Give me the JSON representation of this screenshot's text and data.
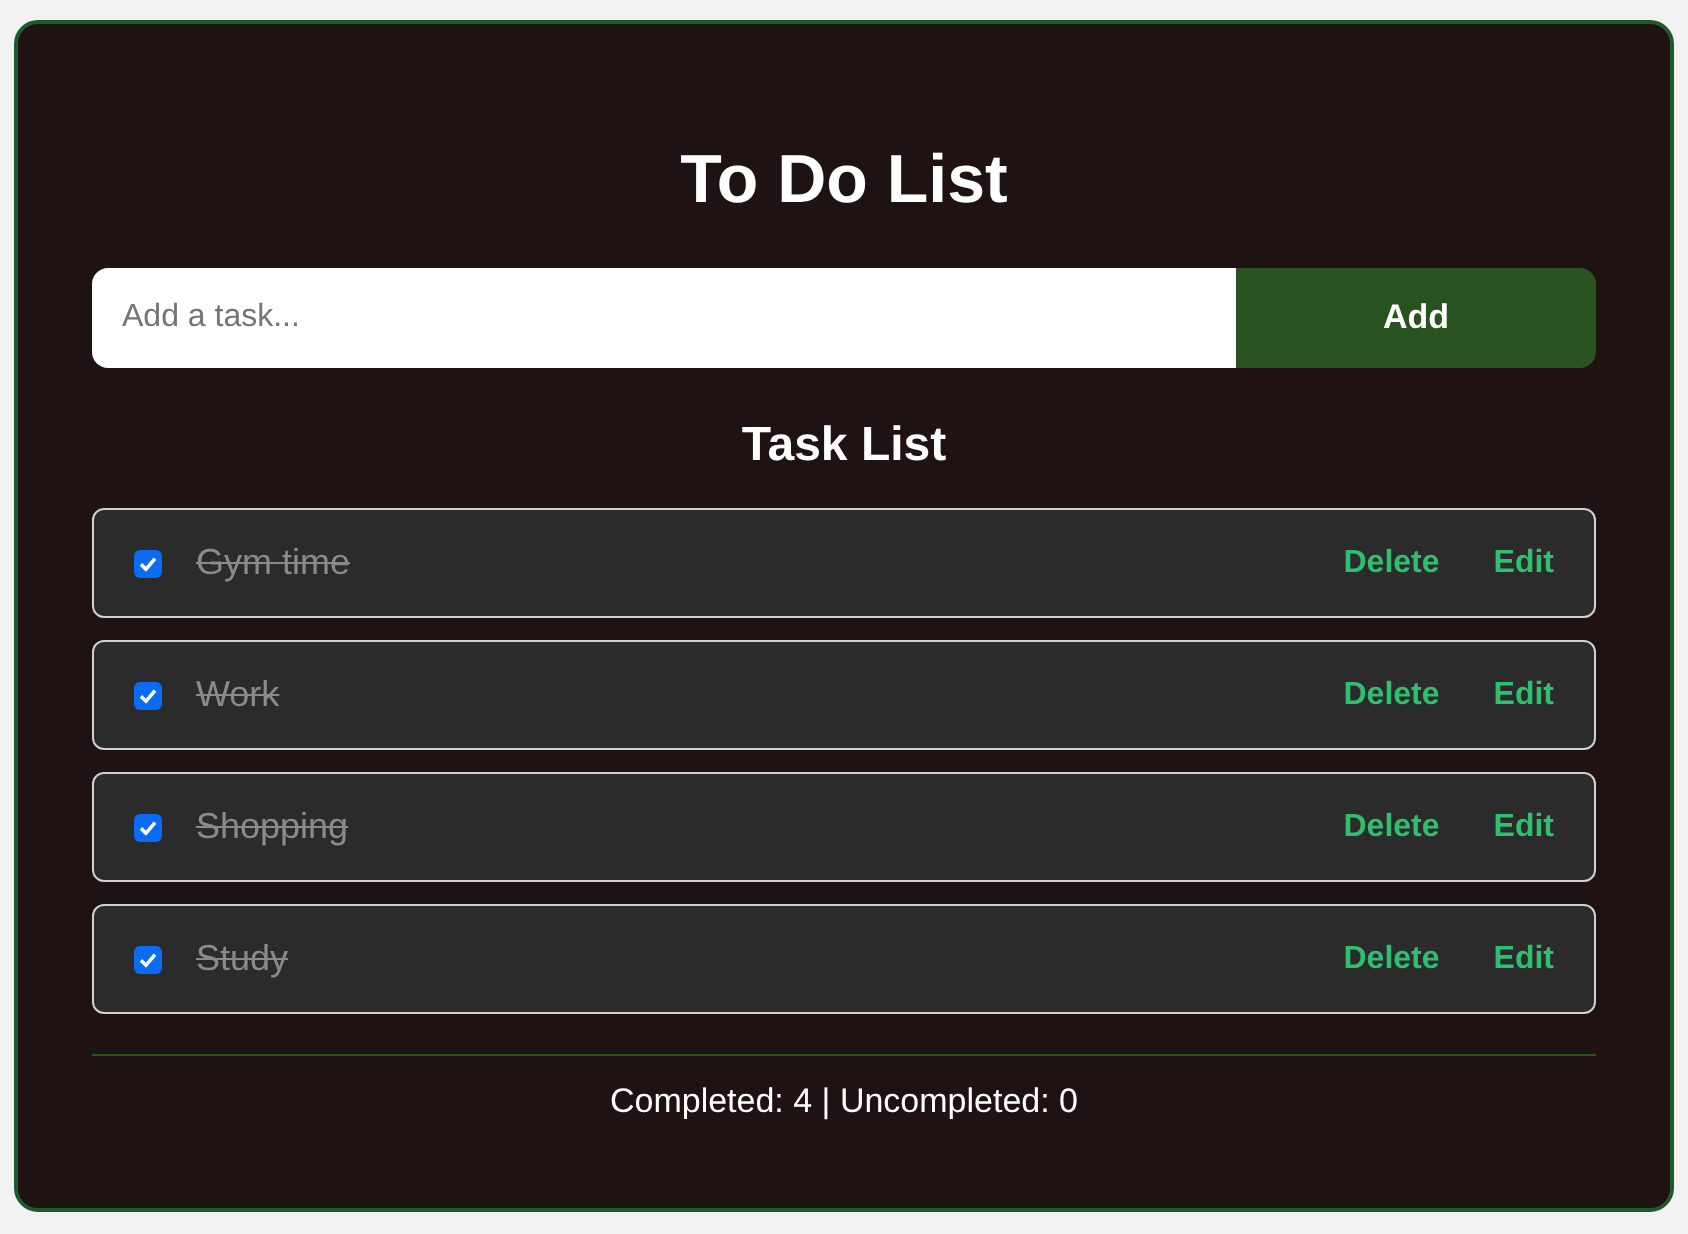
{
  "title": "To Do List",
  "new_task": {
    "placeholder": "Add a task...",
    "button": "Add"
  },
  "list_title": "Task List",
  "tasks": [
    {
      "label": "Gym time",
      "checked": true,
      "delete": "Delete",
      "edit": "Edit"
    },
    {
      "label": "Work",
      "checked": true,
      "delete": "Delete",
      "edit": "Edit"
    },
    {
      "label": "Shopping",
      "checked": true,
      "delete": "Delete",
      "edit": "Edit"
    },
    {
      "label": "Study",
      "checked": true,
      "delete": "Delete",
      "edit": "Edit"
    }
  ],
  "summary": "Completed: 4 | Uncompleted: 0"
}
